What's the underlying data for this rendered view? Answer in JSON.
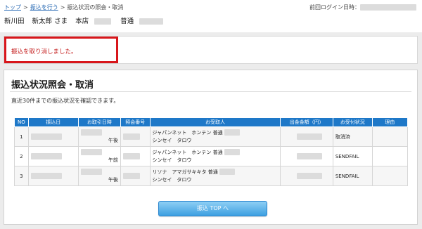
{
  "breadcrumb": {
    "top": "トップ",
    "separator": ">",
    "transfer": "振込を行う",
    "current": "振込状況の照会・取消"
  },
  "last_login_label": "前回ログイン日時：",
  "user": {
    "branch": "新川田",
    "name": "新太郎 さま",
    "branch_name": "本店",
    "account_type": "普通"
  },
  "notice": {
    "message": "振込を取り消しました。",
    "border_color": "#d8161b"
  },
  "panel": {
    "title": "振込状況照会・取消",
    "description": "直近30件までの振込状況を確認できます。"
  },
  "table": {
    "headers": [
      "NO",
      "振込日",
      "お取引日時",
      "照会番号",
      "お受取人",
      "出金金額（円）",
      "お受付状況",
      "理由"
    ],
    "rows": [
      {
        "no": "1",
        "time": "午後",
        "recipient_line1": "ジャパンネット　ホンテン 普通",
        "recipient_line2": "シンセイ　タロウ",
        "status": "取消済"
      },
      {
        "no": "2",
        "time": "午前",
        "recipient_line1": "ジャパンネット　ホンテン 普通",
        "recipient_line2": "シンセイ　タロウ",
        "status": "SENDFAIL"
      },
      {
        "no": "3",
        "time": "午後",
        "recipient_line1": "リソナ　アマガサキキタ 普通",
        "recipient_line2": "シンセイ　タロウ",
        "status": "SENDFAIL"
      }
    ],
    "header_color": "#1e78c8"
  },
  "button": {
    "label": "振込 TOP へ"
  }
}
